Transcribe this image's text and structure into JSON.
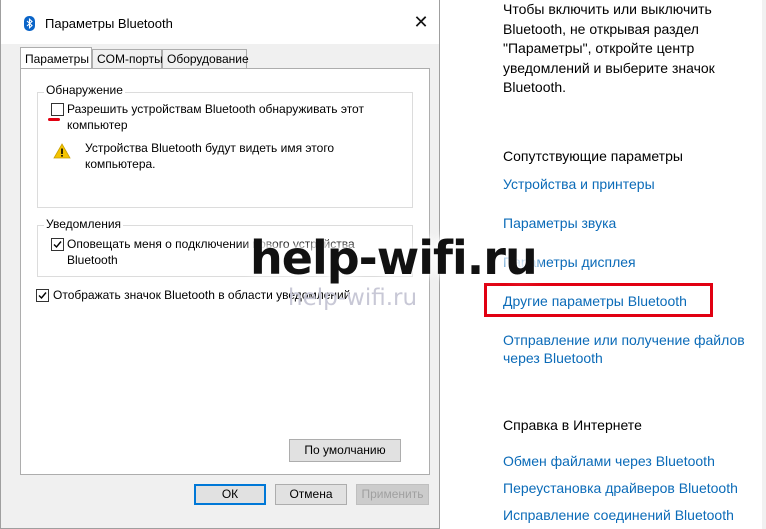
{
  "dialog": {
    "title": "Параметры Bluetooth",
    "close_icon": "close-icon",
    "tabs": [
      {
        "label": "Параметры",
        "active": true
      },
      {
        "label": "COM-порты",
        "active": false
      },
      {
        "label": "Оборудование",
        "active": false
      }
    ],
    "discovery": {
      "group_label": "Обнаружение",
      "allow_label": "Разрешить устройствам Bluetooth обнаруживать этот компьютер",
      "allow_checked": false,
      "warning": "Устройства Bluetooth будут видеть имя этого компьютера."
    },
    "notifications": {
      "group_label": "Уведомления",
      "notify_label": "Оповещать меня о подключении нового устройства Bluetooth",
      "notify_checked": true
    },
    "show_icon_label": "Отображать значок Bluetooth в области уведомлений",
    "show_icon_checked": true,
    "defaults_button": "По умолчанию",
    "ok_button": "ОК",
    "cancel_button": "Отмена",
    "apply_button": "Применить"
  },
  "settings_pane": {
    "intro": "Чтобы включить или выключить Bluetooth, не открывая раздел \"Параметры\", откройте центр уведомлений и выберите значок Bluetooth.",
    "related_heading": "Сопутствующие параметры",
    "related_links": [
      "Устройства и принтеры",
      "Параметры звука",
      "Параметры дисплея",
      "Другие параметры Bluetooth",
      "Отправление или получение файлов через Bluetooth"
    ],
    "help_heading": "Справка в Интернете",
    "help_links": [
      "Обмен файлами через Bluetooth",
      "Переустановка драйверов Bluetooth",
      "Исправление соединений Bluetooth"
    ],
    "highlight_color": "#e10011",
    "link_color": "#0b6bb8"
  },
  "watermark": {
    "big": "help-wifi.ru",
    "small": "help-wifi.ru"
  }
}
